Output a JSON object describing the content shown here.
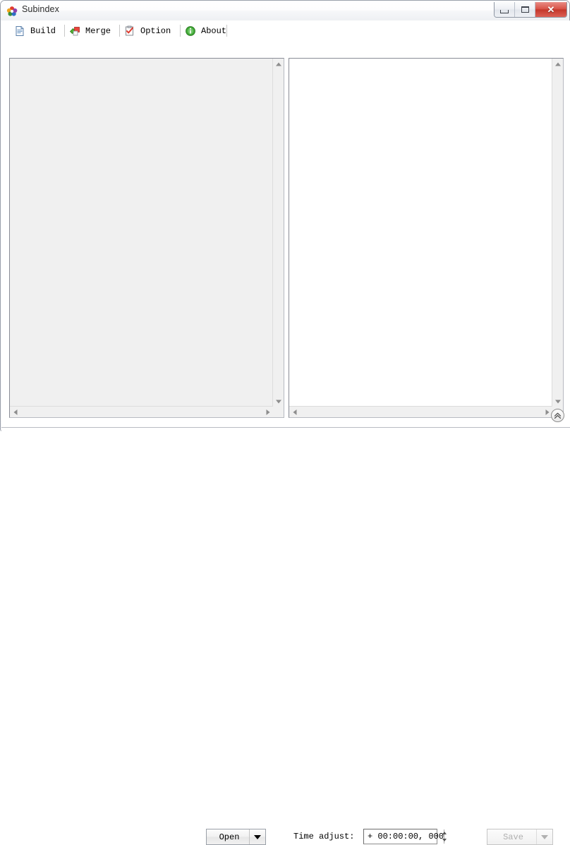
{
  "window": {
    "title": "Subindex",
    "app_icon": "pinwheel-icon",
    "controls": {
      "minimize": "minimize-icon",
      "maximize": "maximize-icon",
      "close": "✕"
    }
  },
  "tabs": [
    {
      "label": "Build",
      "icon": "document-build-icon",
      "selected": true
    },
    {
      "label": "Merge",
      "icon": "puzzle-merge-icon",
      "selected": false
    },
    {
      "label": "Option",
      "icon": "clipboard-option-icon",
      "selected": false
    },
    {
      "label": "About",
      "icon": "info-circle-icon",
      "selected": false
    }
  ],
  "panels": {
    "left": {
      "name": "subtitle-file-list",
      "content": "",
      "background": "#f0f0f0"
    },
    "right": {
      "name": "subtitle-preview",
      "content": "",
      "background": "#ffffff"
    }
  },
  "collapse_button": {
    "icon": "double-chevron-up-icon"
  },
  "toolbar": {
    "open_label": "Open",
    "time_adjust_label": "Time adjust:",
    "time_adjust_value": "+ 00:00:00, 000",
    "save_label": "Save",
    "save_disabled": true
  },
  "scrollbars": {
    "up": "scroll-up-arrow",
    "down": "scroll-down-arrow",
    "left": "scroll-left-arrow",
    "right": "scroll-right-arrow"
  }
}
